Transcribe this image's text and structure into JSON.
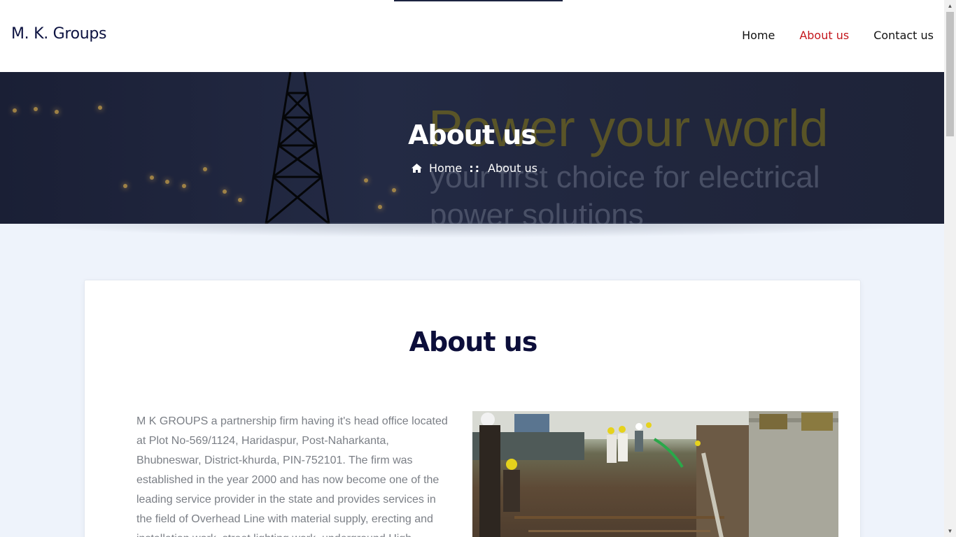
{
  "header": {
    "logo": "M. K. Groups",
    "nav": [
      "Home",
      "About us",
      "Contact us"
    ],
    "active_nav": "About us",
    "active_color": "#c4161c"
  },
  "banner": {
    "title": "About us",
    "breadcrumb_home": "Home",
    "breadcrumb_separator": "::",
    "breadcrumb_current": "About us",
    "home_icon": "home-icon",
    "bg_text_line1": "Power your world",
    "bg_text_line2": "your first choice for electrical",
    "bg_text_line3": "power solutions"
  },
  "section": {
    "title": "About us",
    "paragraph": "M K GROUPS a partnership firm having it's head office located at Plot No-569/1124, Haridaspur, Post-Naharkanta, Bhubneswar, District-khurda, PIN-752101. The firm was established in the year 2000 and has now become one of the leading service provider in the state and provides services in the field of Overhead Line with material supply, erecting and installation work, street lighting work, underground High"
  },
  "colors": {
    "title_navy": "#0c0e3a",
    "page_bg": "#eef3fb"
  }
}
